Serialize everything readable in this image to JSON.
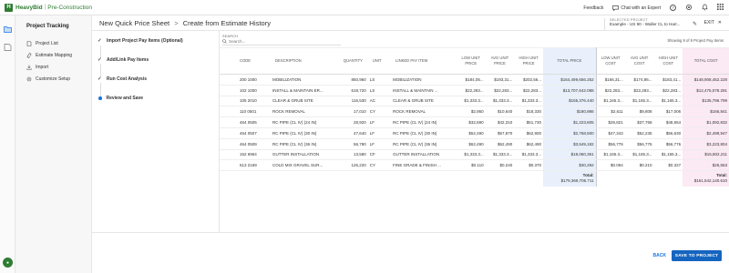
{
  "topbar": {
    "brand_name": "HeavyBid",
    "brand_sep": "|",
    "brand_product": "Pre-Construction",
    "feedback": "Feedback",
    "chat": "Chat with an Expert"
  },
  "leftnav": {
    "title": "Project Tracking",
    "items": [
      {
        "label": "Project List",
        "icon": "document-icon"
      },
      {
        "label": "Estimate Mapping",
        "icon": "link-icon"
      },
      {
        "label": "Import",
        "icon": "import-icon"
      },
      {
        "label": "Customize Setup",
        "icon": "gear-icon"
      }
    ]
  },
  "header": {
    "title": "New Quick Price Sheet",
    "separator": ">",
    "subtitle": "Create from Estimate History",
    "selected_project_label": "SELECTED PROJECT",
    "selected_project_value": "Example - US 90 - Waller CL to Harr...",
    "exit": "EXIT"
  },
  "steps": [
    {
      "label": "Import Project Pay Items (Optional)",
      "state": "done"
    },
    {
      "label": "Add/Link Pay Items",
      "state": "done"
    },
    {
      "label": "Run Cost Analysis",
      "state": "done"
    },
    {
      "label": "Review and Save",
      "state": "current"
    }
  ],
  "search": {
    "label": "SEARCH",
    "placeholder": "Search..."
  },
  "showing": "Showing 9 of 9 Project Pay Items",
  "table": {
    "headers": {
      "code": "CODE",
      "description": "DESCRIPTION",
      "quantity": "QUANTITY",
      "unit": "UNIT",
      "linked": "LINKED PAY ITEM",
      "low_price": "LOW UNIT PRICE",
      "avg_price": "AVG UNIT PRICE",
      "high_price": "HIGH UNIT PRICE",
      "total_price": "TOTAL PRICE",
      "low_cost": "LOW UNIT COST",
      "avg_cost": "AVG UNIT COST",
      "high_cost": "HIGH UNIT COST",
      "total_cost": "TOTAL COST"
    },
    "rows": [
      {
        "code": "200 1000",
        "description": "MOBILIZATION",
        "quantity": "850,960",
        "unit": "LS",
        "linked": "MOBILIZATION",
        "low_price": "$184,05...",
        "avg_price": "$193,31...",
        "high_price": "$202,56...",
        "total_price": "$164,499,656.252",
        "low_cost": "$166,31...",
        "avg_cost": "$174,86...",
        "high_cost": "$183,41...",
        "total_cost": "$148,908,452.228"
      },
      {
        "code": "102 1000",
        "description": "INSTALL & MAINTAIN ER...",
        "quantity": "619,720",
        "unit": "LS",
        "linked": "INSTALL & MAINTAIN ...",
        "low_price": "$22,283...",
        "avg_price": "$22,283...",
        "high_price": "$22,283...",
        "total_price": "$13,707,642.088",
        "low_cost": "$22,283...",
        "avg_cost": "$22,283...",
        "high_cost": "$22,283...",
        "total_cost": "$12,475,078.291"
      },
      {
        "code": "105 2010",
        "description": "CLEAR & GRUB SITE",
        "quantity": "116,530",
        "unit": "AC",
        "linked": "CLEAR & GRUB SITE",
        "low_price": "$1,333.3...",
        "avg_price": "$1,333.3...",
        "high_price": "$1,333.3...",
        "total_price": "$155,376.440",
        "low_cost": "$1,165.3...",
        "avg_cost": "$1,165.3...",
        "high_cost": "$1,165.3...",
        "total_cost": "$135,796.799"
      },
      {
        "code": "110 0501",
        "description": "ROCK REMOVAL",
        "quantity": "17,010",
        "unit": "CY",
        "linked": "ROCK REMOVAL",
        "low_price": "$2,950",
        "avg_price": "$10,640",
        "high_price": "$18,330",
        "total_price": "$180,986",
        "low_cost": "$2,611",
        "avg_cost": "$9,808",
        "high_cost": "$17,006",
        "total_cost": "$166,841"
      },
      {
        "code": "464 0505",
        "description": "RC PIPE (CL IV) (24 IN)",
        "quantity": "28,920",
        "unit": "LF",
        "linked": "RC PIPE (CL IV) (24 IN)",
        "low_price": "$32,690",
        "avg_price": "$42,310",
        "high_price": "$51,730",
        "total_price": "$1,223,605",
        "low_cost": "$26,821",
        "avg_cost": "$37,768",
        "high_cost": "$48,654",
        "total_cost": "$1,092,832"
      },
      {
        "code": "464 0507",
        "description": "RC PIPE (CL IV) (30 IN)",
        "quantity": "47,640",
        "unit": "LF",
        "linked": "RC PIPE (CL IV) (30 IN)",
        "low_price": "$52,490",
        "avg_price": "$57,870",
        "high_price": "$62,900",
        "total_price": "$2,768,500",
        "low_cost": "$47,343",
        "avg_cost": "$52,235",
        "high_cost": "$56,630",
        "total_cost": "$2,499,947"
      },
      {
        "code": "464 0509",
        "description": "RC PIPE (CL IV) (36 IN)",
        "quantity": "56,780",
        "unit": "LF",
        "linked": "RC PIPE (CL IV) (36 IN)",
        "low_price": "$62,490",
        "avg_price": "$62,490",
        "high_price": "$62,490",
        "total_price": "$3,549,182",
        "low_cost": "$56,776",
        "avg_cost": "$56,776",
        "high_cost": "$56,776",
        "total_cost": "$3,223,804"
      },
      {
        "code": "152 6964",
        "description": "GUTTER INSTALLATION",
        "quantity": "13,580",
        "unit": "CF",
        "linked": "GUTTER INSTALLATION",
        "low_price": "$1,333.3...",
        "avg_price": "$1,333.3...",
        "high_price": "$1,333.3...",
        "total_price": "$18,060,361",
        "low_cost": "$1,165.3...",
        "avg_cost": "$1,165.3...",
        "high_cost": "$1,165.3...",
        "total_cost": "$15,802,211"
      },
      {
        "code": "613 2169",
        "description": "COLD MIX GRAVEL SUR...",
        "quantity": "126,220",
        "unit": "CY",
        "linked": "FINE GRADE & FINISH ...",
        "low_price": "$0.110",
        "avg_price": "$0.240",
        "high_price": "$0.370",
        "total_price": "$30,292",
        "low_cost": "$0.094",
        "avg_cost": "$0.210",
        "high_cost": "$0.327",
        "total_cost": "$26,553"
      }
    ],
    "total_label": "Total:",
    "total_price": "$179,369,706.711",
    "total_cost": "$161,542,140.610"
  },
  "footer": {
    "back": "BACK",
    "save": "SAVE TO PROJECT"
  },
  "colors": {
    "brand": "#2e7d32",
    "primary": "#1565c0",
    "total_price_col": "#e9f0fb",
    "total_cost_col": "#fbe9f3"
  }
}
